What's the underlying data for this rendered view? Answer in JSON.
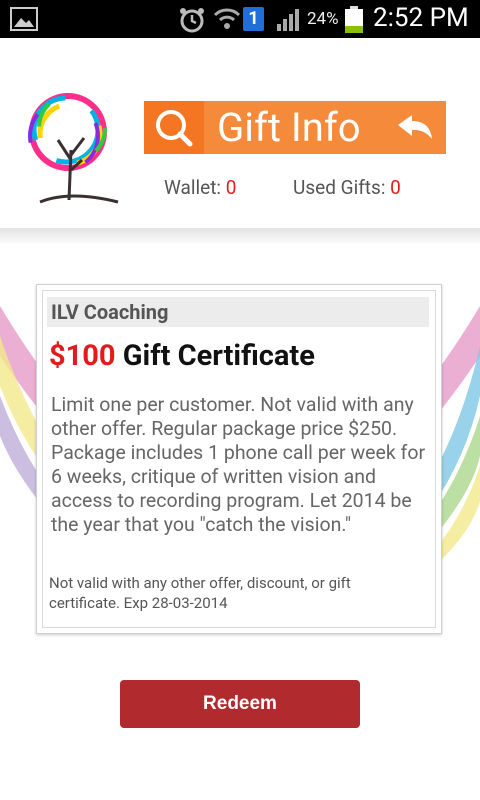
{
  "status_bar": {
    "icons": [
      "gallery-icon",
      "alarm-icon",
      "wifi-icon",
      "notification-badge",
      "signal-icon",
      "battery-icon"
    ],
    "badge": "1",
    "battery_pct": "24%",
    "time": "2:52 PM"
  },
  "header": {
    "title": "Gift Info",
    "wallet_label": "Wallet:",
    "wallet_value": "0",
    "used_label": "Used Gifts:",
    "used_value": "0",
    "colors": {
      "title_bar": "#f58a3b",
      "search_bg": "#f47622",
      "count": "#e21b1b"
    }
  },
  "card": {
    "merchant": "ILV Coaching",
    "amount": "$100",
    "title_rest": "Gift Certificate",
    "description": "Limit one per customer. Not valid with any other offer. Regular package price $250. Package includes 1 phone call per week for 6 weeks, critique of written vision and access to recording program. Let 2014 be the year that you \"catch the vision.\"",
    "fine_print": "Not valid with any other offer, discount, or gift certificate. Exp 28-03-2014"
  },
  "actions": {
    "redeem_label": "Redeem",
    "redeem_color": "#b02a2e"
  }
}
